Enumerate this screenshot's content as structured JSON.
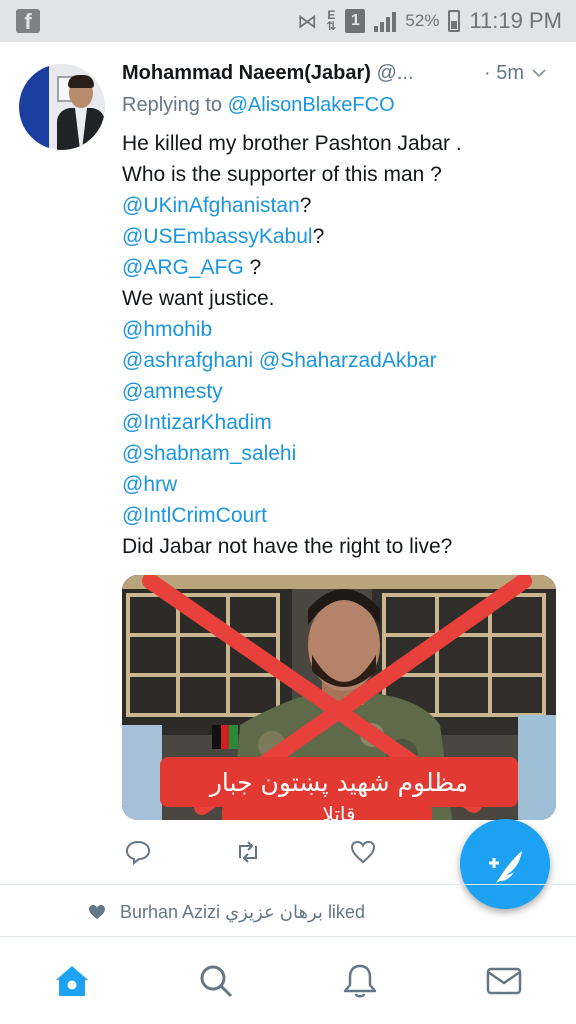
{
  "status_bar": {
    "battery": "52%",
    "time": "11:19 PM",
    "sim_slot": "1",
    "data_indicator": "E",
    "icons": [
      "facebook-icon",
      "mute-icon",
      "data-arrows-icon",
      "sim-icon",
      "signal-icon",
      "battery-icon"
    ]
  },
  "tweet": {
    "name": "Mohammad Naeem(Jabar)",
    "handle": "@...",
    "time": "· 5m",
    "replying_prefix": "Replying to ",
    "replying_to": "@AlisonBlakeFCO",
    "lines": [
      [
        {
          "t": "He killed my brother Pashton Jabar .",
          "m": false
        }
      ],
      [
        {
          "t": "Who is the supporter of this man ?",
          "m": false
        }
      ],
      [
        {
          "t": "@UKinAfghanistan",
          "m": true
        },
        {
          "t": "?",
          "m": false
        }
      ],
      [
        {
          "t": "@USEmbassyKabul",
          "m": true
        },
        {
          "t": "?",
          "m": false
        }
      ],
      [
        {
          "t": "@ARG_AFG",
          "m": true
        },
        {
          "t": " ?",
          "m": false
        }
      ],
      [
        {
          "t": "We want justice.",
          "m": false
        }
      ],
      [
        {
          "t": "@hmohib",
          "m": true
        }
      ],
      [
        {
          "t": "@ashrafghani",
          "m": true
        },
        {
          "t": " ",
          "m": false
        },
        {
          "t": "@ShaharzadAkbar",
          "m": true
        }
      ],
      [
        {
          "t": "@amnesty",
          "m": true
        }
      ],
      [
        {
          "t": "@IntizarKhadim",
          "m": true
        }
      ],
      [
        {
          "t": "@shabnam_salehi",
          "m": true
        }
      ],
      [
        {
          "t": "@hrw",
          "m": true
        }
      ],
      [
        {
          "t": "@IntlCrimCourt",
          "m": true
        }
      ],
      [
        {
          "t": "Did Jabar not have the right to live?",
          "m": false
        }
      ]
    ],
    "image_caption_line1": "مظلوم شهيد پښتون جبار",
    "image_caption_line2": "قاتلا"
  },
  "liked_by": {
    "name": "Burhan Azizi",
    "name_native": "برهان عزيزي",
    "suffix": "liked"
  },
  "colors": {
    "accent": "#1da1f2",
    "mention": "#1b95e0",
    "muted": "#657786",
    "cross": "#e8403a",
    "caption_bg": "#e23a33"
  },
  "tabs": [
    "home-icon",
    "search-icon",
    "notifications-icon",
    "messages-icon"
  ]
}
